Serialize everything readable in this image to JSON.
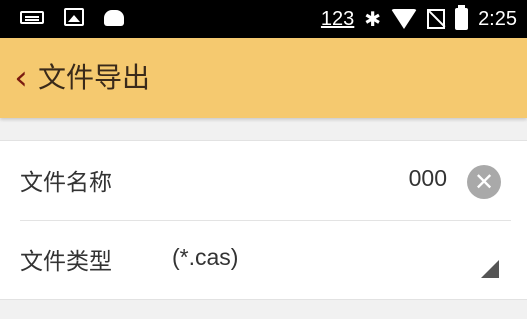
{
  "status_bar": {
    "left_icons": [
      "ime-icon",
      "image-icon",
      "android-icon"
    ],
    "badge_text": "123",
    "right_icons": [
      "bluetooth-icon",
      "wifi-icon",
      "no-signal-icon",
      "battery-icon"
    ],
    "bluetooth_glyph": "✱",
    "time": "2:25"
  },
  "app_bar": {
    "back_glyph": "‹",
    "title": "文件导出",
    "background": "#f5c96f"
  },
  "form": {
    "file_name": {
      "label": "文件名称",
      "value": "000",
      "clear_glyph": "✕"
    },
    "file_type": {
      "label": "文件类型",
      "value": "(*.cas)"
    }
  }
}
